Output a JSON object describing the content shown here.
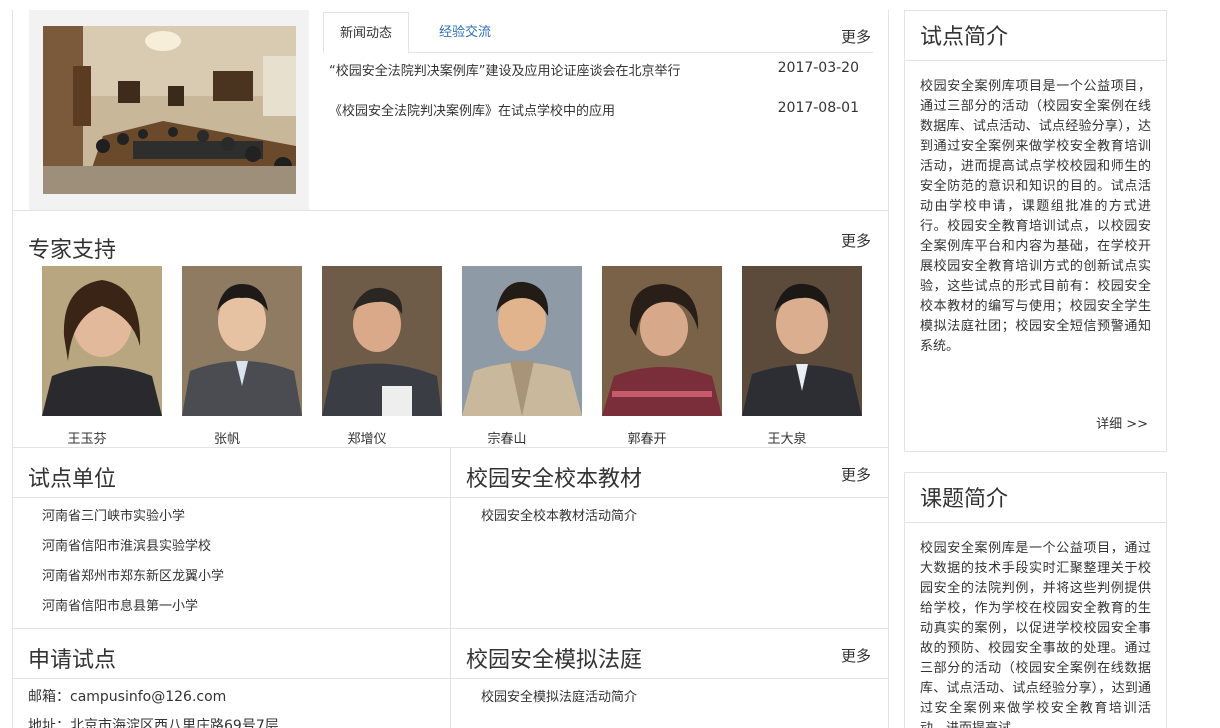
{
  "news": {
    "tabs": [
      "新闻动态",
      "经验交流"
    ],
    "more": "更多",
    "items": [
      {
        "title": "“校园安全法院判决案例库”建设及应用论证座谈会在北京举行",
        "date": "2017-03-20"
      },
      {
        "title": "《校园安全法院判决案例库》在试点学校中的应用",
        "date": "2017-08-01"
      }
    ]
  },
  "experts": {
    "title": "专家支持",
    "more": "更多",
    "people": [
      {
        "name": "王玉芬"
      },
      {
        "name": "张帆"
      },
      {
        "name": "郑增仪"
      },
      {
        "name": "宗春山"
      },
      {
        "name": "郭春开"
      },
      {
        "name": "王大泉"
      }
    ]
  },
  "pilot_units": {
    "title": "试点单位",
    "items": [
      "河南省三门峡市实验小学",
      "河南省信阳市淮滨县实验学校",
      "河南省郑州市郑东新区龙翼小学",
      "河南省信阳市息县第一小学"
    ]
  },
  "textbook": {
    "title": "校园安全校本教材",
    "more": "更多",
    "items": [
      "校园安全校本教材活动简介"
    ]
  },
  "apply": {
    "title": "申请试点",
    "email": "邮箱：campusinfo@126.com",
    "address": "地址：北京市海淀区西八里庄路69号7层"
  },
  "court": {
    "title": "校园安全模拟法庭",
    "more": "更多",
    "items": [
      "校园安全模拟法庭活动简介"
    ]
  },
  "sidebar": {
    "pilot_intro": {
      "title": "试点简介",
      "text": "校园安全案例库项目是一个公益项目，通过三部分的活动（校园安全案例在线数据库、试点活动、试点经验分享），达到通过安全案例来做学校安全教育培训活动，进而提高试点学校校园和师生的安全防范的意识和知识的目的。试点活动由学校申请，课题组批准的方式进行。校园安全教育培训试点，以校园安全案例库平台和内容为基础，在学校开展校园安全教育培训方式的创新试点实验，这些试点的形式目前有：校园安全校本教材的编写与使用；校园安全学生模拟法庭社团；校园安全短信预警通知系统。",
      "more": "详细 >>"
    },
    "topic_intro": {
      "title": "课题简介",
      "text": "校园安全案例库是一个公益项目，通过大数据的技术手段实时汇聚整理关于校园安全的法院判例，并将这些判例提供给学校，作为学校在校园安全教育的生动真实的案例，以促进学校校园安全事故的预防、校园安全事故的处理。通过三部分的活动（校园安全案例在线数据库、试点活动、试点经验分享），达到通过安全案例来做学校安全教育培训活动，进而提高试"
    }
  },
  "colors": {
    "link": "#2a6fb8",
    "border": "#e3e3e3",
    "text": "#333333"
  }
}
